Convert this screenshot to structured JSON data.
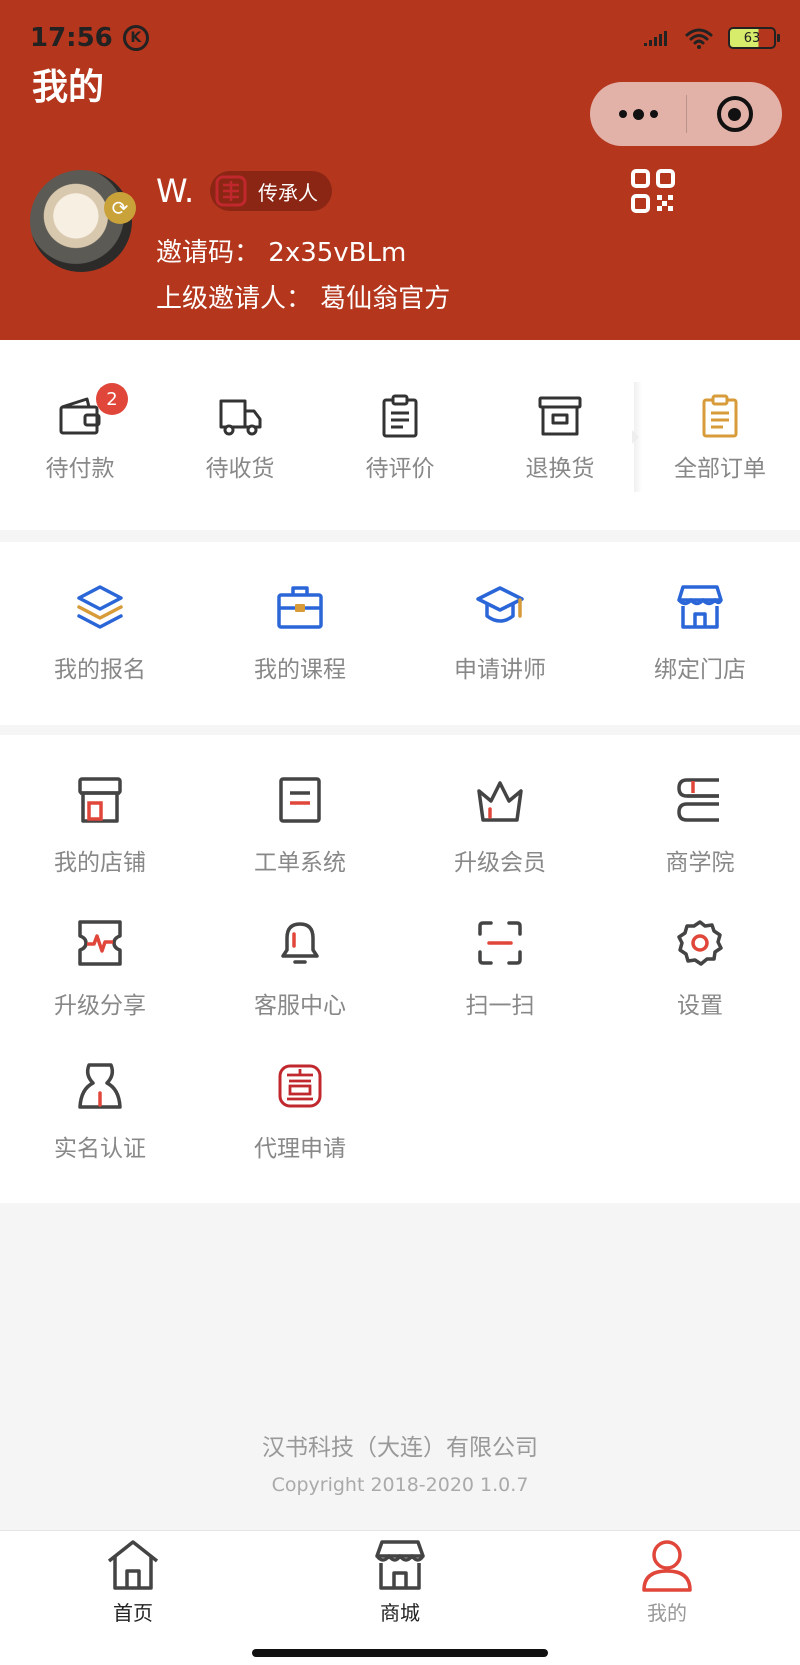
{
  "status_bar": {
    "time": "17:56",
    "k_label": "K",
    "battery": "63"
  },
  "header": {
    "title": "我的",
    "user": {
      "name": "W.",
      "role": "传承人",
      "invite_code_label": "邀请码：",
      "invite_code": "2x35vBLm",
      "inviter_label": "上级邀请人：",
      "inviter": "葛仙翁官方"
    }
  },
  "orders": {
    "items": [
      {
        "label": "待付款",
        "icon": "wallet-icon",
        "badge": "2"
      },
      {
        "label": "待收货",
        "icon": "truck-icon"
      },
      {
        "label": "待评价",
        "icon": "clipboard-icon"
      },
      {
        "label": "退换货",
        "icon": "archive-box-icon"
      },
      {
        "label": "全部订单",
        "icon": "all-orders-icon"
      }
    ]
  },
  "learning": {
    "items": [
      {
        "label": "我的报名",
        "icon": "layers-icon"
      },
      {
        "label": "我的课程",
        "icon": "briefcase-icon"
      },
      {
        "label": "申请讲师",
        "icon": "graduation-cap-icon"
      },
      {
        "label": "绑定门店",
        "icon": "storefront-icon"
      }
    ]
  },
  "tools": {
    "items": [
      {
        "label": "我的店铺",
        "icon": "shop-icon"
      },
      {
        "label": "工单系统",
        "icon": "document-icon"
      },
      {
        "label": "升级会员",
        "icon": "crown-icon"
      },
      {
        "label": "商学院",
        "icon": "books-icon"
      },
      {
        "label": "升级分享",
        "icon": "share-ticket-icon"
      },
      {
        "label": "客服中心",
        "icon": "bell-icon"
      },
      {
        "label": "扫一扫",
        "icon": "scan-icon"
      },
      {
        "label": "设置",
        "icon": "gear-icon"
      },
      {
        "label": "实名认证",
        "icon": "id-person-icon"
      },
      {
        "label": "代理申请",
        "icon": "agent-seal-icon"
      }
    ]
  },
  "footer": {
    "company": "汉书科技（大连）有限公司",
    "copyright": "Copyright 2018-2020 1.0.7"
  },
  "tabbar": {
    "items": [
      {
        "label": "首页",
        "icon": "home-icon"
      },
      {
        "label": "商城",
        "icon": "store-icon"
      },
      {
        "label": "我的",
        "icon": "person-icon",
        "active": true
      }
    ]
  },
  "colors": {
    "brand": "#b3361d",
    "accent_red": "#e0463a",
    "blue": "#2a66d8",
    "gold": "#d89b3a"
  }
}
